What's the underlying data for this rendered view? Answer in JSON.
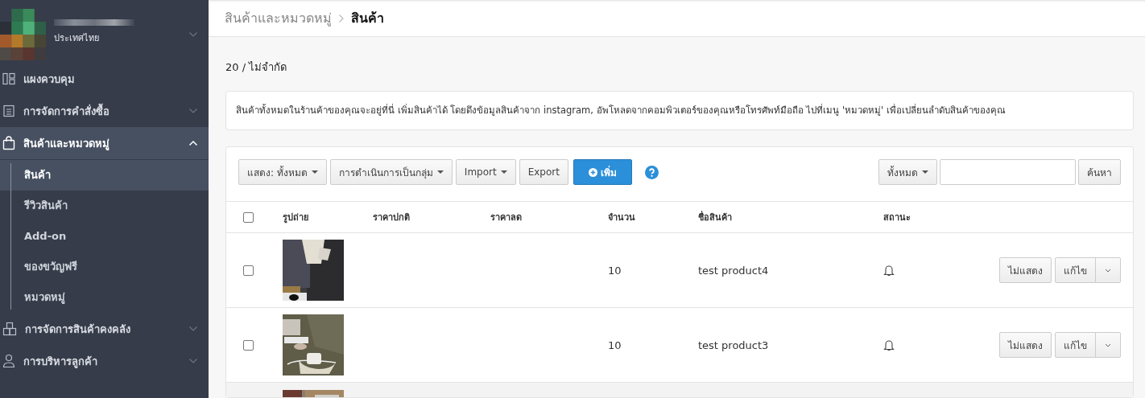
{
  "sidebar": {
    "store": {
      "country": "ประเทศไทย"
    },
    "items": [
      {
        "label": "แผงควบคุม",
        "kind": "dashboard",
        "expanded": false
      },
      {
        "label": "การจัดการคำสั่งซื้อ",
        "kind": "orders",
        "expanded": false
      },
      {
        "label": "สินค้าและหมวดหมู่",
        "kind": "products",
        "expanded": true,
        "children": [
          {
            "label": "สินค้า",
            "selected": true
          },
          {
            "label": "รีวิวสินค้า",
            "selected": false
          },
          {
            "label": "Add-on",
            "selected": false
          },
          {
            "label": "ของขวัญฟรี",
            "selected": false
          },
          {
            "label": "หมวดหมู่",
            "selected": false
          }
        ]
      },
      {
        "label": "การจัดการสินค้าคงคลัง",
        "kind": "inventory",
        "expanded": false
      },
      {
        "label": "การบริหารลูกค้า",
        "kind": "customers",
        "expanded": false
      }
    ]
  },
  "breadcrumb": [
    {
      "label": "สินค้าและหมวดหมู่",
      "selected": false
    },
    {
      "label": "สินค้า",
      "selected": true
    }
  ],
  "quota": "20 / ไม่จำกัด",
  "info": "สินค้าทั้งหมดในร้านค้าของคุณจะอยู่ที่นี่ เพิ่มสินค้าได้ โดยดึงข้อมูลสินค้าจาก instagram, อัพโหลดจากคอมพิวเตอร์ของคุณหรือโทรศัพท์มือถือ ไปที่เมนู 'หมวดหมู่' เพื่อเปลี่ยนลำดับสินค้าของคุณ",
  "toolbar": [
    {
      "label": "แสดง: ทั้งหมด",
      "kind": "dropdown"
    },
    {
      "label": "การดำเนินการเป็นกลุ่ม",
      "kind": "dropdown"
    },
    {
      "label": "Import",
      "kind": "dropdown"
    },
    {
      "label": "Export",
      "kind": "plain"
    },
    {
      "label": "เพิ่ม",
      "kind": "primary"
    }
  ],
  "search": {
    "filter": "ทั้งหมด",
    "button": "ค้นหา"
  },
  "table": {
    "select_all": {
      "checked": false
    },
    "columns": [
      "รูปถ่าย",
      "ราคาปกติ",
      "ราคาลด",
      "จำนวน",
      "ชื่อสินค้า",
      "สถานะ"
    ],
    "rows": [
      {
        "checked": false,
        "quantity": "10",
        "name": "test product4",
        "actions": [
          "ไม่แสดง",
          "แก้ไข"
        ],
        "hovered": false
      },
      {
        "checked": false,
        "quantity": "10",
        "name": "test product3",
        "actions": [
          "ไม่แสดง",
          "แก้ไข"
        ],
        "hovered": false
      },
      {
        "kind": "partial",
        "hovered": true
      }
    ]
  }
}
